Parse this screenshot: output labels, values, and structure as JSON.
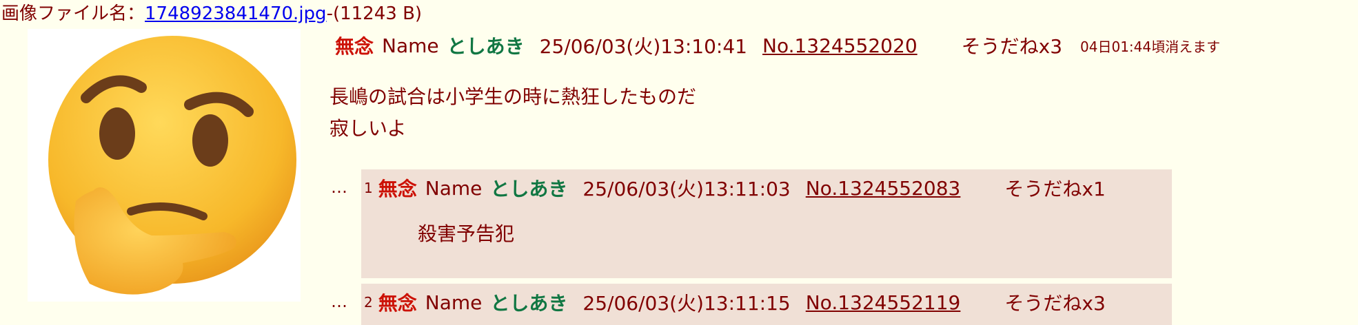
{
  "file": {
    "label": "画像ファイル名：",
    "name": "1748923841470.jpg",
    "size": "-(11243 B)"
  },
  "post": {
    "subject": "無念",
    "name_label": "Name",
    "name": "としあき",
    "date": "25/06/03(火)13:10:41",
    "number": "No.1324552020",
    "sodane": "そうだねx3",
    "expire": "04日01:44頃消えます",
    "body": [
      "長嶋の試合は小学生の時に熱狂したものだ",
      "寂しいよ"
    ]
  },
  "replies": [
    {
      "dots": "…",
      "index": "1",
      "subject": "無念",
      "name_label": "Name",
      "name": "としあき",
      "date": "25/06/03(火)13:11:03",
      "number": "No.1324552083",
      "sodane": "そうだねx1",
      "body": "殺害予告犯"
    },
    {
      "dots": "…",
      "index": "2",
      "subject": "無念",
      "name_label": "Name",
      "name": "としあき",
      "date": "25/06/03(火)13:11:15",
      "number": "No.1324552119",
      "sodane": "そうだねx3",
      "body": ""
    }
  ],
  "thumbnail": {
    "icon": "thinking-face-emoji",
    "face_color": "#f7b82a"
  }
}
